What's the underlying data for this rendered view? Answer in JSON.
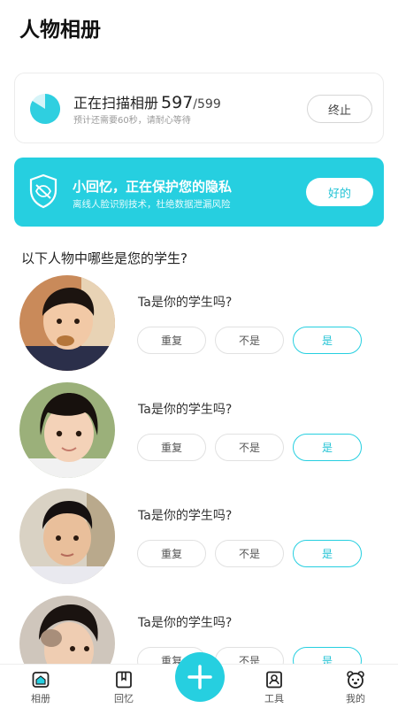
{
  "header": {
    "title": "人物相册"
  },
  "scan": {
    "label": "正在扫描相册",
    "count": "597",
    "total": "/599",
    "progress": 0.9967,
    "hint": "预计还需要60秒，请耐心等待",
    "stop_label": "终止",
    "icon": "progress-circle-icon"
  },
  "privacy": {
    "title": "小回忆，正在保护您的隐私",
    "subtitle": "离线人脸识别技术，杜绝数据泄漏风险",
    "ok_label": "好的",
    "icon": "shield-eye-off-icon",
    "color": "#26cfe0"
  },
  "question": {
    "heading": "以下人物中哪些是您的学生?"
  },
  "people": [
    {
      "question": "Ta是你的学生吗?",
      "dup_label": "重复",
      "no_label": "不是",
      "yes_label": "是"
    },
    {
      "question": "Ta是你的学生吗?",
      "dup_label": "重复",
      "no_label": "不是",
      "yes_label": "是"
    },
    {
      "question": "Ta是你的学生吗?",
      "dup_label": "重复",
      "no_label": "不是",
      "yes_label": "是"
    },
    {
      "question": "Ta是你的学生吗?",
      "dup_label": "重复",
      "no_label": "不是",
      "yes_label": "是"
    }
  ],
  "nav": {
    "items": [
      {
        "label": "相册",
        "icon": "album-icon"
      },
      {
        "label": "回忆",
        "icon": "bookmark-icon"
      },
      {
        "label": "工具",
        "icon": "tool-icon"
      },
      {
        "label": "我的",
        "icon": "bear-icon"
      }
    ],
    "fab_icon": "plus-icon"
  }
}
